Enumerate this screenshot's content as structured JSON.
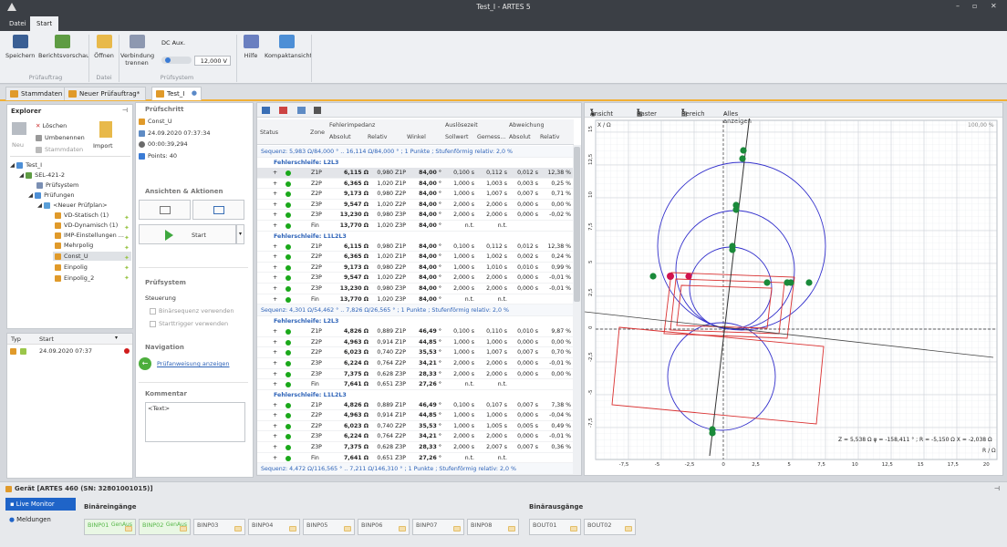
{
  "window": {
    "title": "Test_I - ARTES 5"
  },
  "menu": {
    "file": "Datei",
    "start": "Start"
  },
  "ribbon": {
    "buttons": {
      "save": "Speichern",
      "preview": "Berichtsvorschau",
      "open": "Öffnen",
      "disconnect": "Verbindung trennen",
      "help": "Hilfe",
      "compact": "Kompaktansicht"
    },
    "dc_label": "DC Aux.",
    "dc_value": "12,000 V",
    "groups": {
      "pruefauftrag": "Prüfauftrag",
      "datei": "Datei",
      "pruefsystem": "Prüfsystem"
    }
  },
  "tabs": [
    "Stammdaten",
    "Neuer Prüfauftrag*",
    "Test_I"
  ],
  "explorer": {
    "title": "Explorer",
    "tools": {
      "neu": "Neu",
      "loeschen": "Löschen",
      "umbenennen": "Umbenennen",
      "stammdaten": "Stammdaten",
      "import": "Import"
    },
    "tree": [
      "Test_I",
      "SEL-421-2",
      "Prüfsystem",
      "Prüfungen",
      "<Neuer Prüfplan>",
      "VD-Statisch (1)",
      "VD-Dynamisch (1)",
      "IMP-Einstellungen ...",
      "Mehrpolig",
      "Const_U",
      "Einpolig",
      "Einpolig_2"
    ],
    "list": {
      "col_typ": "Typ",
      "col_start": "Start",
      "row_start": "24.09.2020 07:37"
    }
  },
  "pruefschritt": {
    "title": "Prüfschritt",
    "name": "Const_U",
    "date": "24.09.2020 07:37:34",
    "duration": "00:00:39,294",
    "points": "Points: 40"
  },
  "actions": {
    "title": "Ansichten & Aktionen",
    "start": "Start"
  },
  "pruefsystem": {
    "title": "Prüfsystem",
    "steuerung": "Steuerung",
    "binaer": "Binärsequenz verwenden",
    "trigger": "Starttrigger verwenden"
  },
  "navigation": {
    "title": "Navigation",
    "link": "Prüfanweisung anzeigen"
  },
  "kommentar": {
    "title": "Kommentar",
    "text": "<Text>"
  },
  "table": {
    "headers": {
      "status": "Status",
      "zone": "Zone",
      "fehlerimpedanz": "Fehlerimpedanz",
      "absolut": "Absolut",
      "relativ": "Relativ",
      "winkel": "Winkel",
      "ausloesezeit": "Auslösezeit",
      "sollwert": "Sollwert",
      "gemessen": "Gemess...",
      "abweichung": "Abweichung",
      "abs2": "Absolut",
      "rel2": "Relativ"
    },
    "groups": [
      {
        "seq": "Sequenz: 5,983 Ω/84,000 ° .. 16,114 Ω/84,000 ° ; 1 Punkte ; Stufenförmig relativ: 2,0 %",
        "loops": [
          {
            "name": "Fehlerschleife: L2L3",
            "rows": [
              [
                "Z1P",
                "6,115 Ω",
                "0,980 Z1P",
                "84,00 °",
                "0,100 s",
                "0,112 s",
                "0,012 s",
                "12,38 %"
              ],
              [
                "Z2P",
                "6,365 Ω",
                "1,020 Z1P",
                "84,00 °",
                "1,000 s",
                "1,003 s",
                "0,003 s",
                "0,25 %"
              ],
              [
                "Z2P",
                "9,173 Ω",
                "0,980 Z2P",
                "84,00 °",
                "1,000 s",
                "1,007 s",
                "0,007 s",
                "0,71 %"
              ],
              [
                "Z3P",
                "9,547 Ω",
                "1,020 Z2P",
                "84,00 °",
                "2,000 s",
                "2,000 s",
                "0,000 s",
                "0,00 %"
              ],
              [
                "Z3P",
                "13,230 Ω",
                "0,980 Z3P",
                "84,00 °",
                "2,000 s",
                "2,000 s",
                "0,000 s",
                "-0,02 %"
              ],
              [
                "Fin",
                "13,770 Ω",
                "1,020 Z3P",
                "84,00 °",
                "n.t.",
                "n.t.",
                "",
                ""
              ]
            ]
          },
          {
            "name": "Fehlerschleife: L1L2L3",
            "rows": [
              [
                "Z1P",
                "6,115 Ω",
                "0,980 Z1P",
                "84,00 °",
                "0,100 s",
                "0,112 s",
                "0,012 s",
                "12,38 %"
              ],
              [
                "Z2P",
                "6,365 Ω",
                "1,020 Z1P",
                "84,00 °",
                "1,000 s",
                "1,002 s",
                "0,002 s",
                "0,24 %"
              ],
              [
                "Z2P",
                "9,173 Ω",
                "0,980 Z2P",
                "84,00 °",
                "1,000 s",
                "1,010 s",
                "0,010 s",
                "0,99 %"
              ],
              [
                "Z3P",
                "9,547 Ω",
                "1,020 Z2P",
                "84,00 °",
                "2,000 s",
                "2,000 s",
                "0,000 s",
                "-0,01 %"
              ],
              [
                "Z3P",
                "13,230 Ω",
                "0,980 Z3P",
                "84,00 °",
                "2,000 s",
                "2,000 s",
                "0,000 s",
                "-0,01 %"
              ],
              [
                "Fin",
                "13,770 Ω",
                "1,020 Z3P",
                "84,00 °",
                "n.t.",
                "n.t.",
                "",
                ""
              ]
            ]
          }
        ]
      },
      {
        "seq": "Sequenz: 4,301 Ω/54,462 ° .. 7,826 Ω/26,565 ° ; 1 Punkte ; Stufenförmig relativ: 2,0 %",
        "loops": [
          {
            "name": "Fehlerschleife: L2L3",
            "rows": [
              [
                "Z1P",
                "4,826 Ω",
                "0,889 Z1P",
                "46,49 °",
                "0,100 s",
                "0,110 s",
                "0,010 s",
                "9,87 %"
              ],
              [
                "Z2P",
                "4,963 Ω",
                "0,914 Z1P",
                "44,85 °",
                "1,000 s",
                "1,000 s",
                "0,000 s",
                "0,00 %"
              ],
              [
                "Z2P",
                "6,023 Ω",
                "0,740 Z2P",
                "35,53 °",
                "1,000 s",
                "1,007 s",
                "0,007 s",
                "0,70 %"
              ],
              [
                "Z3P",
                "6,224 Ω",
                "0,764 Z2P",
                "34,21 °",
                "2,000 s",
                "2,000 s",
                "0,000 s",
                "-0,01 %"
              ],
              [
                "Z3P",
                "7,375 Ω",
                "0,628 Z3P",
                "28,33 °",
                "2,000 s",
                "2,000 s",
                "0,000 s",
                "0,00 %"
              ],
              [
                "Fin",
                "7,641 Ω",
                "0,651 Z3P",
                "27,26 °",
                "n.t.",
                "n.t.",
                "",
                ""
              ]
            ]
          },
          {
            "name": "Fehlerschleife: L1L2L3",
            "rows": [
              [
                "Z1P",
                "4,826 Ω",
                "0,889 Z1P",
                "46,49 °",
                "0,100 s",
                "0,107 s",
                "0,007 s",
                "7,38 %"
              ],
              [
                "Z2P",
                "4,963 Ω",
                "0,914 Z1P",
                "44,85 °",
                "1,000 s",
                "1,000 s",
                "0,000 s",
                "-0,04 %"
              ],
              [
                "Z2P",
                "6,023 Ω",
                "0,740 Z2P",
                "35,53 °",
                "1,000 s",
                "1,005 s",
                "0,005 s",
                "0,49 %"
              ],
              [
                "Z3P",
                "6,224 Ω",
                "0,764 Z2P",
                "34,21 °",
                "2,000 s",
                "2,000 s",
                "0,000 s",
                "-0,01 %"
              ],
              [
                "Z3P",
                "7,375 Ω",
                "0,628 Z3P",
                "28,33 °",
                "2,000 s",
                "2,007 s",
                "0,007 s",
                "0,36 %"
              ],
              [
                "Fin",
                "7,641 Ω",
                "0,651 Z3P",
                "27,26 °",
                "n.t.",
                "n.t.",
                "",
                ""
              ]
            ]
          }
        ]
      }
    ],
    "last_seq": "Sequenz: 4,472 Ω/116,565 ° .. 7,211 Ω/146,310 ° ; 1 Punkte ; Stufenförmig relativ: 2,0 %"
  },
  "plot": {
    "tools": {
      "ansicht": "Ansicht",
      "raster": "Raster",
      "bereich": "Bereich",
      "alles": "Alles anzeigen"
    },
    "zoom": "100,00 %",
    "xlabel": "R / Ω",
    "ylabel": "X / Ω",
    "status": "Z = 5,538 Ω  φ = -158,411 ° ; R = -5,150 Ω  X = -2,038 Ω",
    "xticks": [
      "-7,5",
      "-5",
      "-2,5",
      "0",
      "2,5",
      "5",
      "7,5",
      "10",
      "12,5",
      "15",
      "17,5",
      "20"
    ],
    "yticks": [
      "15",
      "12,5",
      "10",
      "7,5",
      "5",
      "2,5",
      "0",
      "-2,5",
      "-5",
      "-7,5"
    ]
  },
  "device": {
    "title": "Gerät [ARTES 460 (SN: 32801001015)]",
    "live": "Live Monitor",
    "meldungen": "Meldungen",
    "inputs_title": "Binäreingänge",
    "outputs_title": "Binärausgänge",
    "inputs": [
      "BINP01",
      "BINP02",
      "BINP03",
      "BINP04",
      "BINP05",
      "BINP06",
      "BINP07",
      "BINP08"
    ],
    "gen_aus": "GenAus",
    "outputs": [
      "BOUT01",
      "BOUT02"
    ]
  }
}
